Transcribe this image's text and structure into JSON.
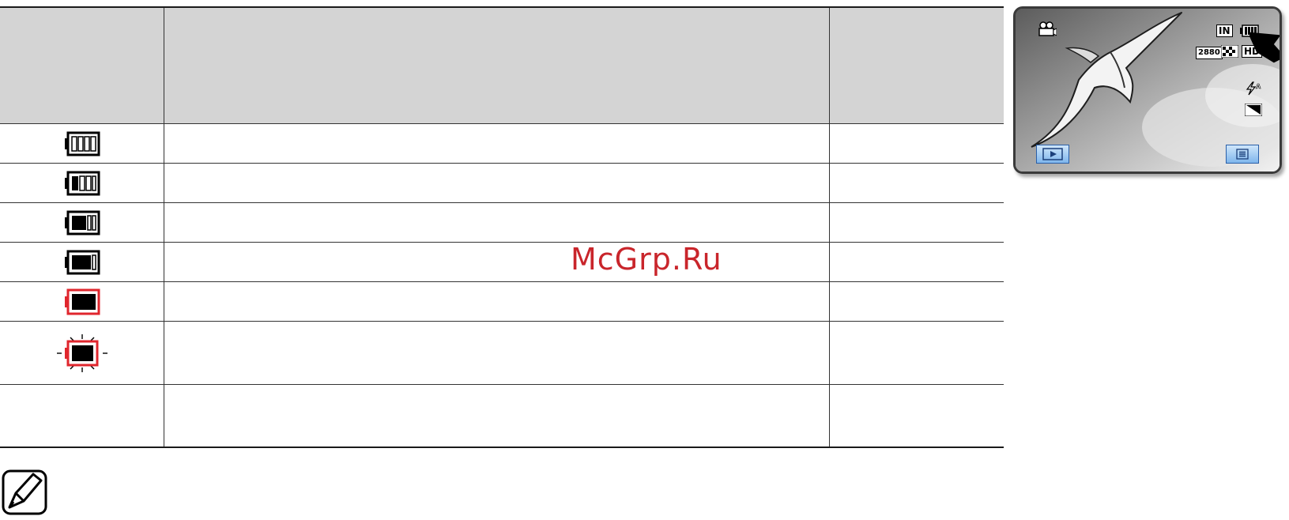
{
  "table": {
    "rows": [
      {
        "icon": "battery-level-4-icon",
        "level": "4/4"
      },
      {
        "icon": "battery-level-3-icon",
        "level": "3/4"
      },
      {
        "icon": "battery-level-2-icon",
        "level": "2/4"
      },
      {
        "icon": "battery-level-1-icon",
        "level": "1/4"
      },
      {
        "icon": "battery-empty-icon",
        "level": "0/4"
      },
      {
        "icon": "battery-empty-blinking-icon",
        "level": "0/4"
      }
    ],
    "colors": {
      "header_bg": "#d4d4d4",
      "warning_red": "#e0262d",
      "rule": "#333333"
    }
  },
  "watermark": {
    "text": "McGrp.Ru",
    "color": "#c9252b"
  },
  "lcd_screen": {
    "mode_icon": "video-camera-icon",
    "storage_label": "IN",
    "resolution_label": "2880",
    "quality_icon": "super-fine-icon",
    "hd_label": "HD",
    "flash_icon": "flash-auto-icon",
    "exposure_icon": "exposure-icon",
    "play_button_icon": "play-icon",
    "menu_button_icon": "menu-icon",
    "battery_icon": "battery-level-4-icon"
  },
  "note": {
    "icon": "note-pencil-icon"
  }
}
